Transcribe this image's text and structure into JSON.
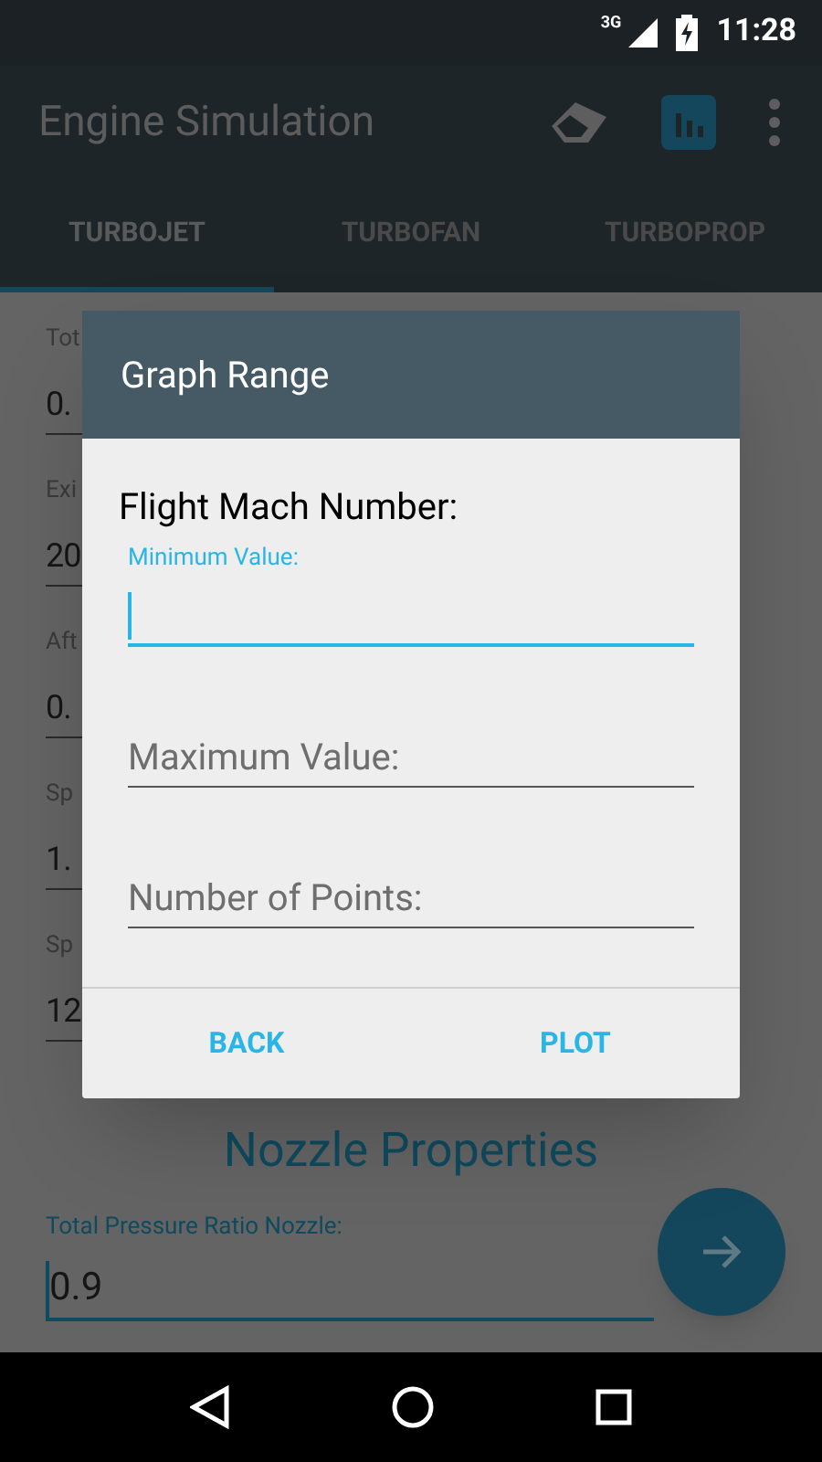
{
  "status_bar": {
    "network": "3G",
    "time": "11:28"
  },
  "app_bar": {
    "title": "Engine Simulation",
    "actions": [
      {
        "kind": "eraser",
        "highlighted": false
      },
      {
        "kind": "chart",
        "highlighted": true
      },
      {
        "kind": "overflow",
        "highlighted": false
      }
    ]
  },
  "tabs": [
    {
      "label": "TURBOJET",
      "selected": true
    },
    {
      "label": "TURBOFAN",
      "selected": false
    },
    {
      "label": "TURBOPROP",
      "selected": false
    }
  ],
  "fields": [
    {
      "label": "Tot",
      "value": "0."
    },
    {
      "label": "Exi",
      "value": "20"
    },
    {
      "label": "Aft",
      "value": "0."
    },
    {
      "label": "Sp",
      "value": "1."
    },
    {
      "label": "Sp",
      "value": "12"
    }
  ],
  "section": {
    "title": "Nozzle Properties",
    "field": {
      "label": "Total Pressure Ratio Nozzle:",
      "value": "0.9"
    }
  },
  "dialog": {
    "title": "Graph Range",
    "heading": "Flight Mach Number:",
    "inputs": [
      {
        "placeholder": "Minimum Value:",
        "focused": true
      },
      {
        "placeholder": "Maximum Value:",
        "focused": false
      },
      {
        "placeholder": "Number of Points:",
        "focused": false
      }
    ],
    "buttons": [
      "BACK",
      "PLOT"
    ]
  }
}
